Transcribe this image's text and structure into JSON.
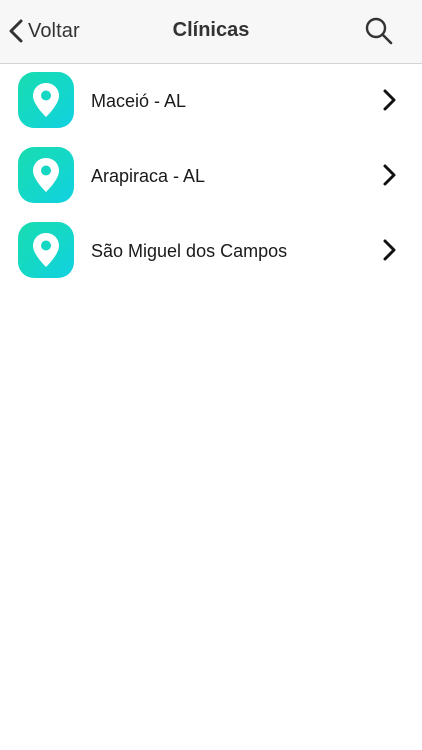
{
  "navbar": {
    "back_label": "Voltar",
    "title": "Clínicas",
    "back_icon": "chevron-left-icon",
    "search_icon": "search-icon"
  },
  "clinics": [
    {
      "label": "Maceió - AL",
      "icon": "location-pin-icon"
    },
    {
      "label": "Arapiraca - AL",
      "icon": "location-pin-icon"
    },
    {
      "label": "São Miguel dos Campos",
      "icon": "location-pin-icon"
    }
  ],
  "colors": {
    "accent_start": "#19dcb0",
    "accent_end": "#12d0e2",
    "navbar_bg": "#f7f7f7",
    "text": "#1a1a1a"
  }
}
